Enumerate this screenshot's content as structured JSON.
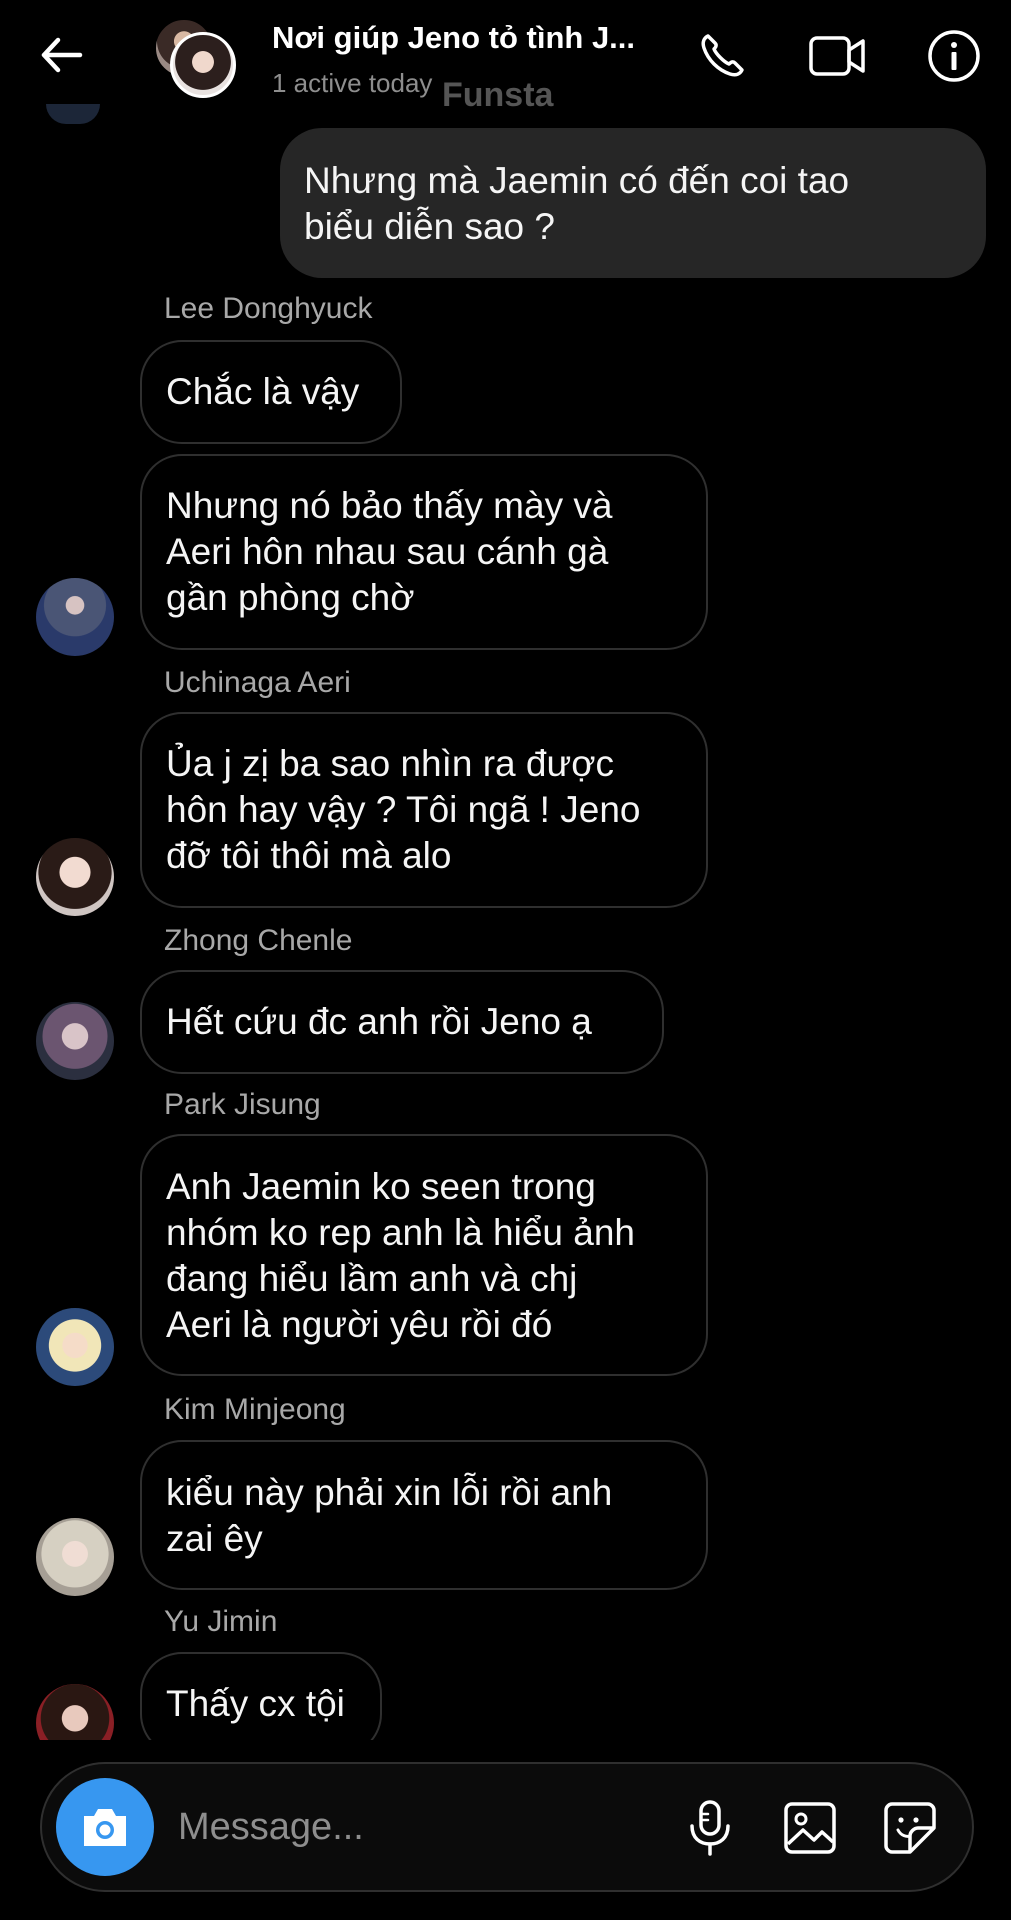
{
  "header": {
    "title": "Nơi giúp Jeno tỏ tình J...",
    "status": "1 active today",
    "watermark": "Funsta"
  },
  "messages": {
    "sent_1": {
      "lines": [
        "Nhưng mà Jaemin có đến coi tao",
        "biểu diễn sao ?"
      ]
    },
    "donghyuck": {
      "sender": "Lee Donghyuck",
      "msg_1": [
        "Chắc là vậy"
      ],
      "msg_2": [
        "Nhưng nó bảo thấy mày và",
        "Aeri hôn nhau sau cánh gà",
        "gần phòng chờ"
      ]
    },
    "aeri": {
      "sender": "Uchinaga Aeri",
      "msg_1": [
        "Ủa j zị ba sao nhìn ra được",
        "hôn hay vậy ? Tôi ngã ! Jeno",
        "đỡ tôi thôi mà alo"
      ]
    },
    "chenle": {
      "sender": "Zhong Chenle",
      "msg_1": [
        "Hết cứu đc anh rồi Jeno ạ"
      ]
    },
    "jisung": {
      "sender": "Park Jisung",
      "msg_1": [
        "Anh Jaemin ko seen trong",
        "nhóm ko rep anh là hiểu ảnh",
        "đang hiểu lầm anh và chj",
        "Aeri là người yêu rồi đó"
      ]
    },
    "minjeong": {
      "sender": "Kim Minjeong",
      "msg_1": [
        "kiểu này phải xin lỗi rồi anh",
        "zai êy"
      ]
    },
    "jimin": {
      "sender": "Yu Jimin",
      "msg_1": [
        "Thấy cx tội"
      ]
    }
  },
  "composer": {
    "placeholder": "Message..."
  },
  "icons": {
    "back": "arrow-left-icon",
    "call": "phone-icon",
    "video": "video-camera-icon",
    "info": "info-icon",
    "camera": "camera-icon",
    "mic": "microphone-icon",
    "gallery": "image-icon",
    "sticker": "sticker-icon"
  },
  "colors": {
    "background": "#000000",
    "sent_bubble": "#262626",
    "received_border": "#2f2f2f",
    "accent": "#3797f0",
    "secondary_text": "#a8a8a8"
  }
}
